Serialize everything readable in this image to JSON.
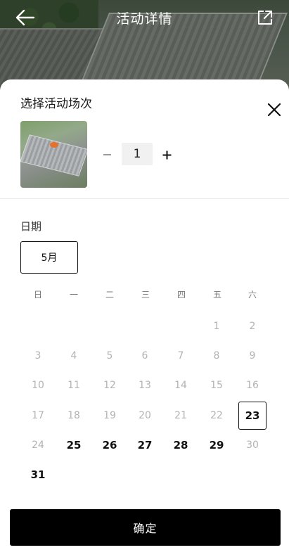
{
  "header": {
    "title": "活动详情",
    "back_icon": "arrow-left-icon",
    "share_icon": "share-external-icon"
  },
  "sheet": {
    "title": "选择活动场次",
    "close_icon": "close-icon",
    "quantity": "1",
    "minus_icon": "minus-icon",
    "plus_icon": "plus-icon"
  },
  "date": {
    "label": "日期",
    "month": "5月",
    "weekdays": [
      "日",
      "一",
      "二",
      "三",
      "四",
      "五",
      "六"
    ],
    "days": [
      {
        "d": "1",
        "state": "off"
      },
      {
        "d": "2",
        "state": "off"
      },
      {
        "d": "3",
        "state": "off"
      },
      {
        "d": "4",
        "state": "off"
      },
      {
        "d": "5",
        "state": "off"
      },
      {
        "d": "6",
        "state": "off"
      },
      {
        "d": "7",
        "state": "off"
      },
      {
        "d": "8",
        "state": "off"
      },
      {
        "d": "9",
        "state": "off"
      },
      {
        "d": "10",
        "state": "off"
      },
      {
        "d": "11",
        "state": "off"
      },
      {
        "d": "12",
        "state": "off"
      },
      {
        "d": "13",
        "state": "off"
      },
      {
        "d": "14",
        "state": "off"
      },
      {
        "d": "15",
        "state": "off"
      },
      {
        "d": "16",
        "state": "off"
      },
      {
        "d": "17",
        "state": "off"
      },
      {
        "d": "18",
        "state": "off"
      },
      {
        "d": "19",
        "state": "off"
      },
      {
        "d": "20",
        "state": "off"
      },
      {
        "d": "21",
        "state": "off"
      },
      {
        "d": "22",
        "state": "off"
      },
      {
        "d": "23",
        "state": "selected"
      },
      {
        "d": "24",
        "state": "off"
      },
      {
        "d": "25",
        "state": "on"
      },
      {
        "d": "26",
        "state": "on"
      },
      {
        "d": "27",
        "state": "on"
      },
      {
        "d": "28",
        "state": "on"
      },
      {
        "d": "29",
        "state": "on"
      },
      {
        "d": "30",
        "state": "off"
      },
      {
        "d": "31",
        "state": "on"
      }
    ]
  },
  "footer": {
    "confirm_label": "确定"
  }
}
